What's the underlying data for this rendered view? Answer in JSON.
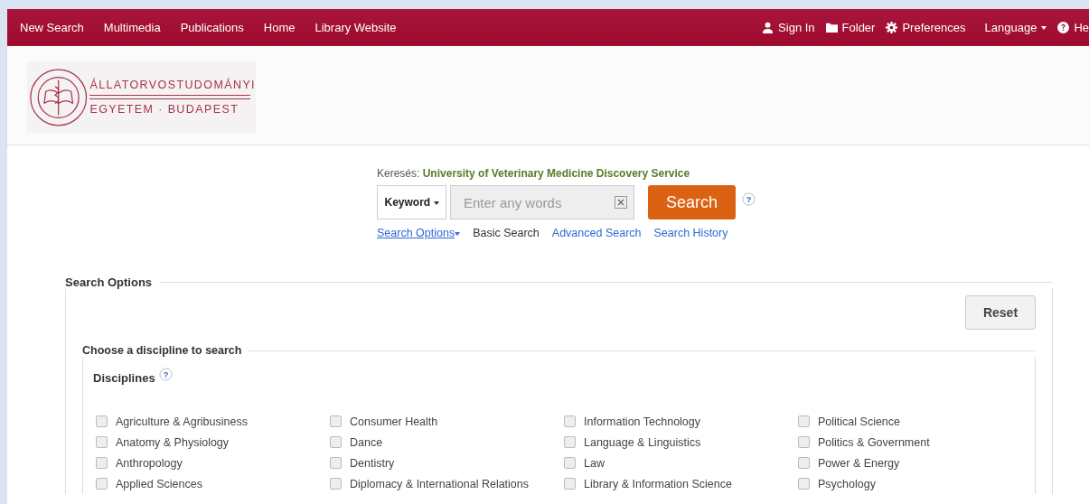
{
  "top_nav": {
    "left": [
      "New Search",
      "Multimedia",
      "Publications",
      "Home",
      "Library Website"
    ],
    "right": [
      {
        "kind": "user",
        "label": "Sign In"
      },
      {
        "kind": "folder",
        "label": "Folder"
      },
      {
        "kind": "gear",
        "label": "Preferences"
      },
      {
        "kind": "dropdown",
        "label": "Language"
      },
      {
        "kind": "help",
        "label": "He"
      }
    ]
  },
  "logo": {
    "line_1": "ÁLLATORVOSTUDOMÁNYI",
    "line_2": "EGYETEM · BUDAPEST"
  },
  "search": {
    "prefix": "Keresés:",
    "service": "University of Veterinary Medicine Discovery Service",
    "field_type": "Keyword",
    "placeholder": "Enter any words",
    "button": "Search",
    "help_mark": "?",
    "links": [
      {
        "label": "Search Options",
        "selected": true
      },
      {
        "label": "Basic Search",
        "selected": false
      },
      {
        "label": "Advanced Search",
        "selected": false
      },
      {
        "label": "Search History",
        "selected": false
      }
    ]
  },
  "options": {
    "title": "Search Options",
    "reset": "Reset",
    "discipline_title": "Choose a discipline to search",
    "disciplines_label": "Disciplines",
    "help_mark": "?",
    "columns": [
      [
        {
          "label": "Agriculture & Agribusiness",
          "checked": false
        },
        {
          "label": "Anatomy & Physiology",
          "checked": false
        },
        {
          "label": "Anthropology",
          "checked": false
        },
        {
          "label": "Applied Sciences",
          "checked": false
        }
      ],
      [
        {
          "label": "Consumer Health",
          "checked": false
        },
        {
          "label": "Dance",
          "checked": false
        },
        {
          "label": "Dentistry",
          "checked": false
        },
        {
          "label": "Diplomacy & International Relations",
          "checked": false
        }
      ],
      [
        {
          "label": "Information Technology",
          "checked": false
        },
        {
          "label": "Language & Linguistics",
          "checked": false
        },
        {
          "label": "Law",
          "checked": false
        },
        {
          "label": "Library & Information Science",
          "checked": false
        }
      ],
      [
        {
          "label": "Political Science",
          "checked": false
        },
        {
          "label": "Politics & Government",
          "checked": false
        },
        {
          "label": "Power & Energy",
          "checked": false
        },
        {
          "label": "Psychology",
          "checked": false
        }
      ]
    ]
  }
}
